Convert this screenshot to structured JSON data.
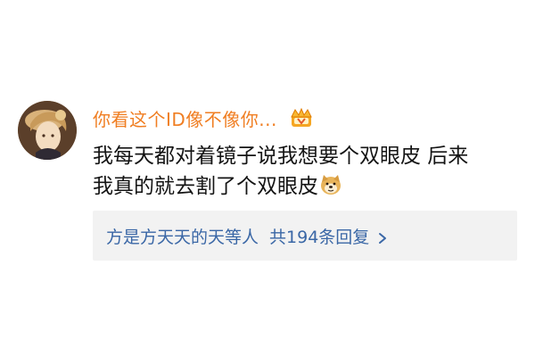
{
  "comment": {
    "username": "你看这个ID像不像你...",
    "badge_icon": "crown-badge-icon",
    "text_line1": "我每天都对着镜子说我想要个双眼皮 后来",
    "text_line2": "我真的就去割了个双眼皮",
    "emoji_icon": "doge-emoji-icon",
    "replies": {
      "names": "方是方天天的天",
      "suffix": "等人",
      "count_label": "共194条回复"
    }
  },
  "colors": {
    "username": "#f07e22",
    "link": "#3a67a6",
    "reply_bg": "#f2f2f2"
  }
}
